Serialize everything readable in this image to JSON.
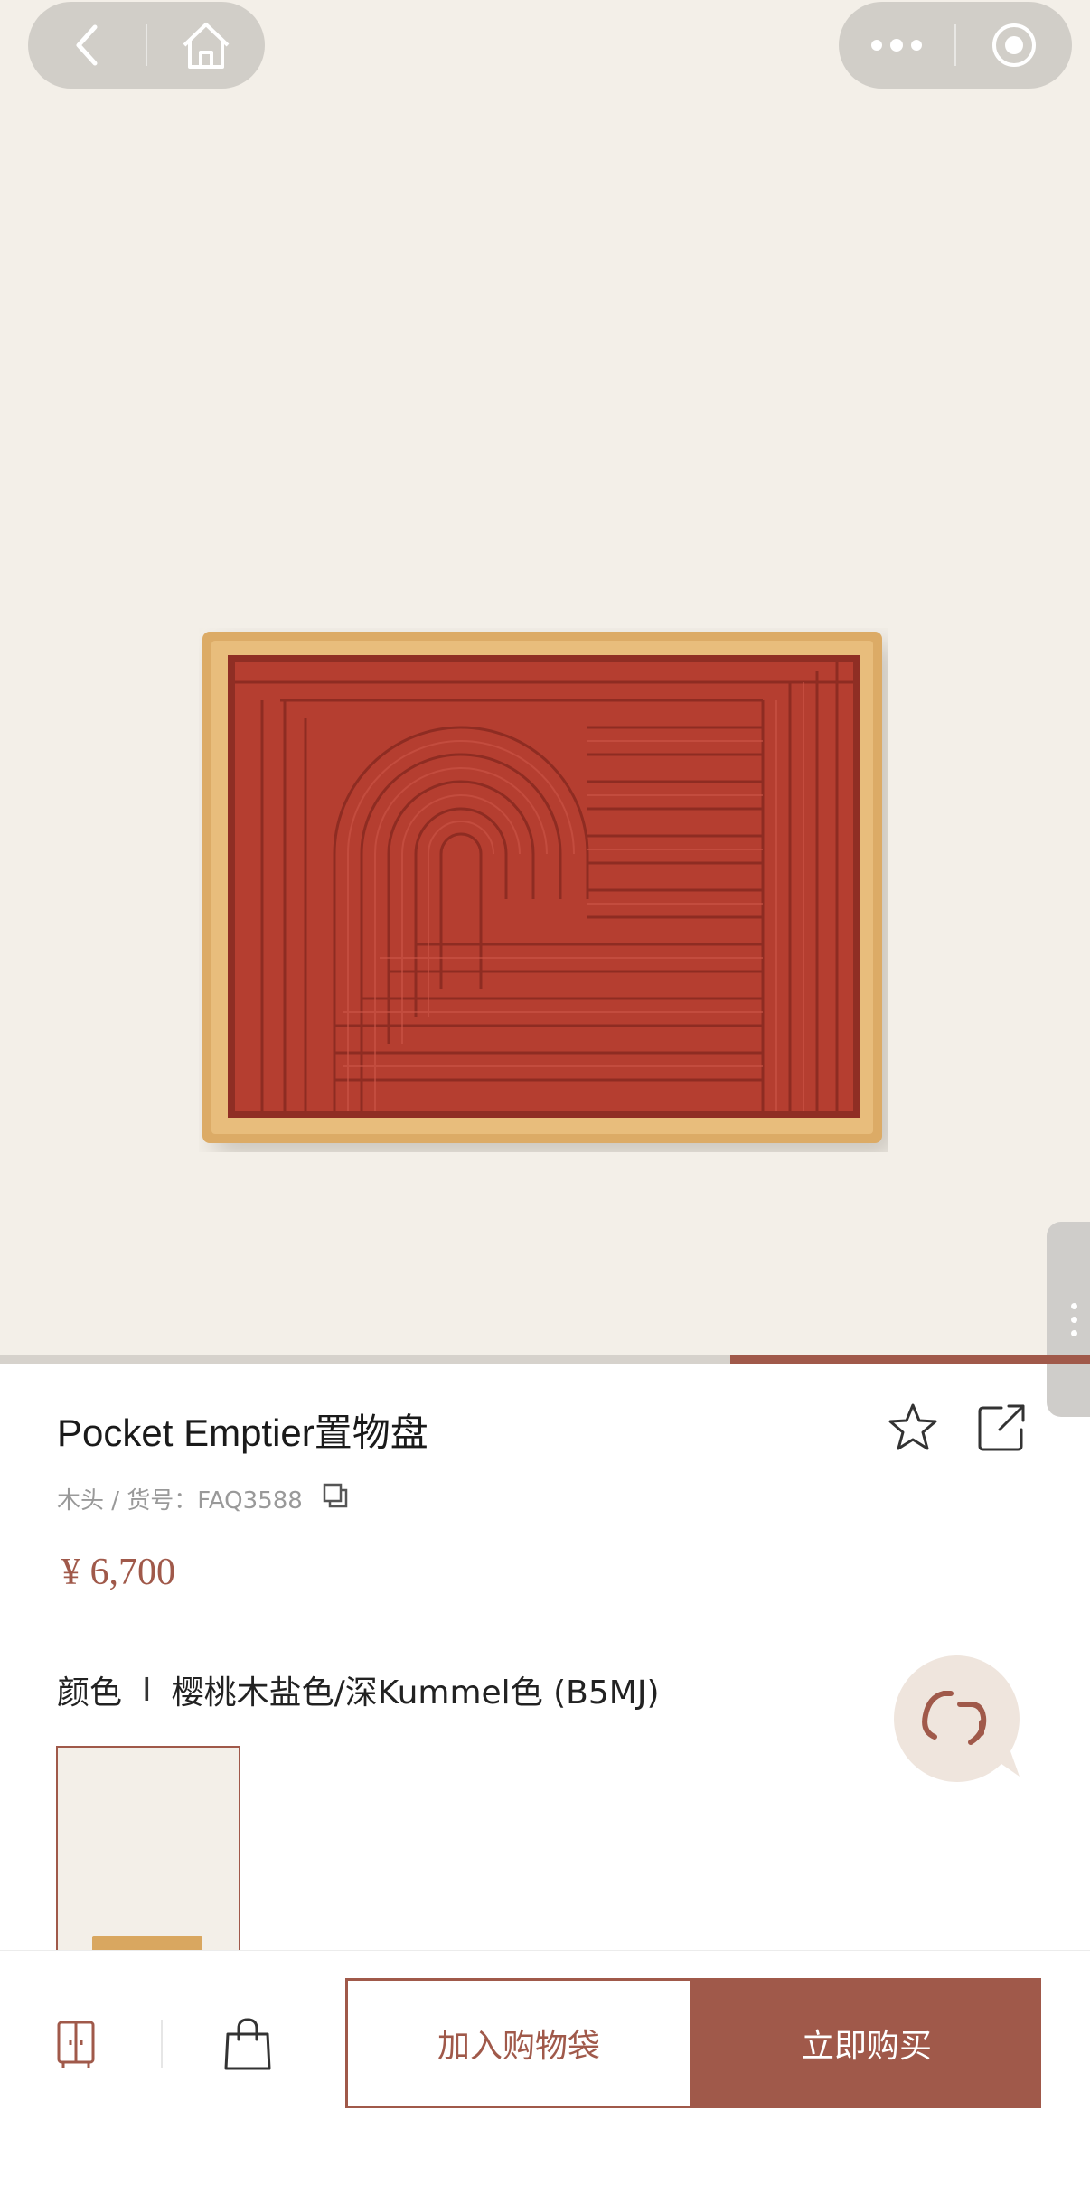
{
  "product": {
    "title": "Pocket Emptier置物盘",
    "meta": "木头 / 货号：FAQ3588",
    "price": "¥ 6,700",
    "color_label": "颜色",
    "color_separator": "I",
    "color_value": "樱桃木盐色/深Kummel色 (B5MJ)"
  },
  "image_carousel": {
    "progress": 0.33
  },
  "actions": {
    "add_to_bag": "加入购物袋",
    "buy_now": "立即购买"
  },
  "colors": {
    "accent": "#a0594a",
    "hero_bg": "#f3efe8",
    "tray_wood": "#d9a760",
    "tray_leather": "#b53e30"
  },
  "icons": [
    "back-icon",
    "home-icon",
    "more-icon",
    "close-mini-program-icon",
    "star-icon",
    "share-icon",
    "copy-icon",
    "chat-icon",
    "wardrobe-icon",
    "shopping-bag-icon"
  ]
}
